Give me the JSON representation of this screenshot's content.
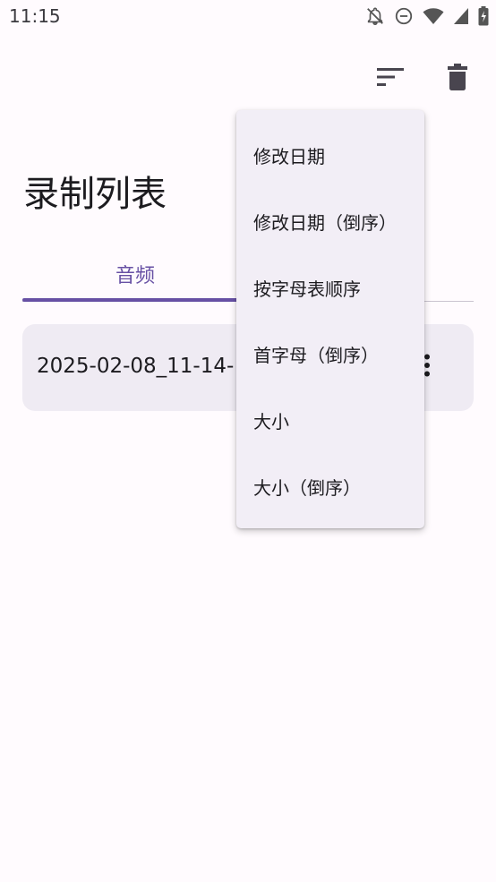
{
  "status_bar": {
    "time": "11:15",
    "icons": [
      "notifications-off-icon",
      "do-not-disturb-icon",
      "wifi-icon",
      "signal-icon",
      "battery-charging-icon"
    ]
  },
  "toolbar": {
    "sort_icon": "sort-icon",
    "delete_icon": "delete-icon"
  },
  "page": {
    "title": "录制列表"
  },
  "tabs": [
    {
      "label": "音频",
      "selected": true
    }
  ],
  "recordings": [
    {
      "name": "2025-02-08_11-14-"
    }
  ],
  "sort_menu": {
    "items": [
      {
        "label": "修改日期"
      },
      {
        "label": "修改日期（倒序）"
      },
      {
        "label": "按字母表顺序"
      },
      {
        "label": "首字母（倒序）"
      },
      {
        "label": "大小"
      },
      {
        "label": "大小（倒序）"
      }
    ]
  },
  "colors": {
    "accent": "#6750a4",
    "background": "#fffbfe",
    "card": "#efebf3",
    "menu": "#f2eef6"
  }
}
